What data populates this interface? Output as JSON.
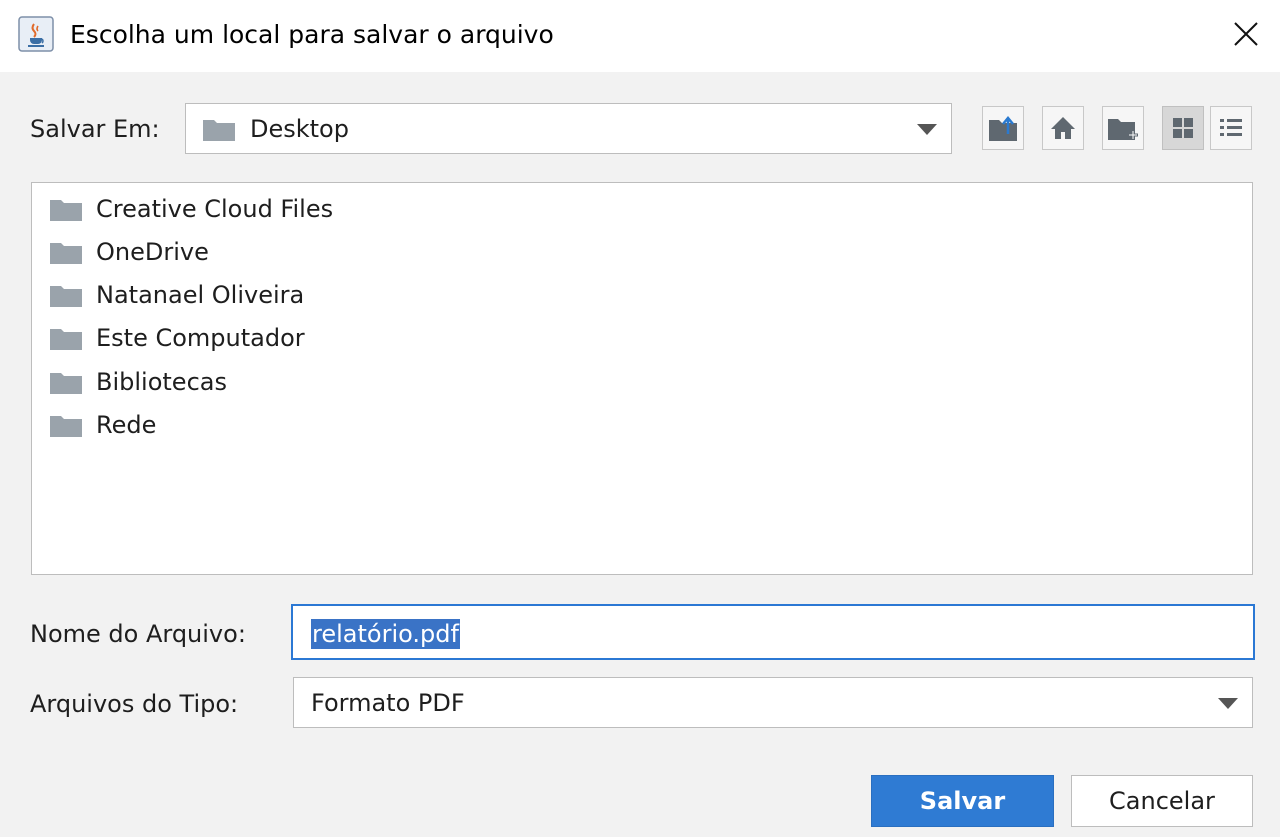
{
  "window": {
    "title": "Escolha um local para salvar o arquivo",
    "app_icon": "java-coffee-cup-icon",
    "close_icon": "close-icon"
  },
  "save_in": {
    "label": "Salvar Em:",
    "value": "Desktop",
    "icon": "folder-icon"
  },
  "toolbar": {
    "buttons": [
      {
        "name": "up-one-level",
        "icon": "folder-up-icon"
      },
      {
        "name": "home",
        "icon": "home-icon"
      },
      {
        "name": "create-new-folder",
        "icon": "new-folder-icon"
      },
      {
        "name": "list-view",
        "icon": "list-view-icon",
        "selected": true
      },
      {
        "name": "details-view",
        "icon": "details-view-icon",
        "selected": false
      }
    ]
  },
  "files": [
    {
      "name": "Creative Cloud Files",
      "icon": "folder-icon"
    },
    {
      "name": "OneDrive",
      "icon": "folder-icon"
    },
    {
      "name": "Natanael Oliveira",
      "icon": "folder-icon"
    },
    {
      "name": "Este Computador",
      "icon": "folder-icon"
    },
    {
      "name": "Bibliotecas",
      "icon": "folder-icon"
    },
    {
      "name": "Rede",
      "icon": "folder-icon"
    }
  ],
  "file_name": {
    "label": "Nome do Arquivo:",
    "value": "relatório.pdf"
  },
  "file_type": {
    "label": "Arquivos do Tipo:",
    "value": "Formato PDF"
  },
  "buttons": {
    "save": "Salvar",
    "cancel": "Cancelar"
  },
  "colors": {
    "accent": "#2f7bd3",
    "selection": "#3a73c6",
    "folder": "#9aa3ab"
  }
}
